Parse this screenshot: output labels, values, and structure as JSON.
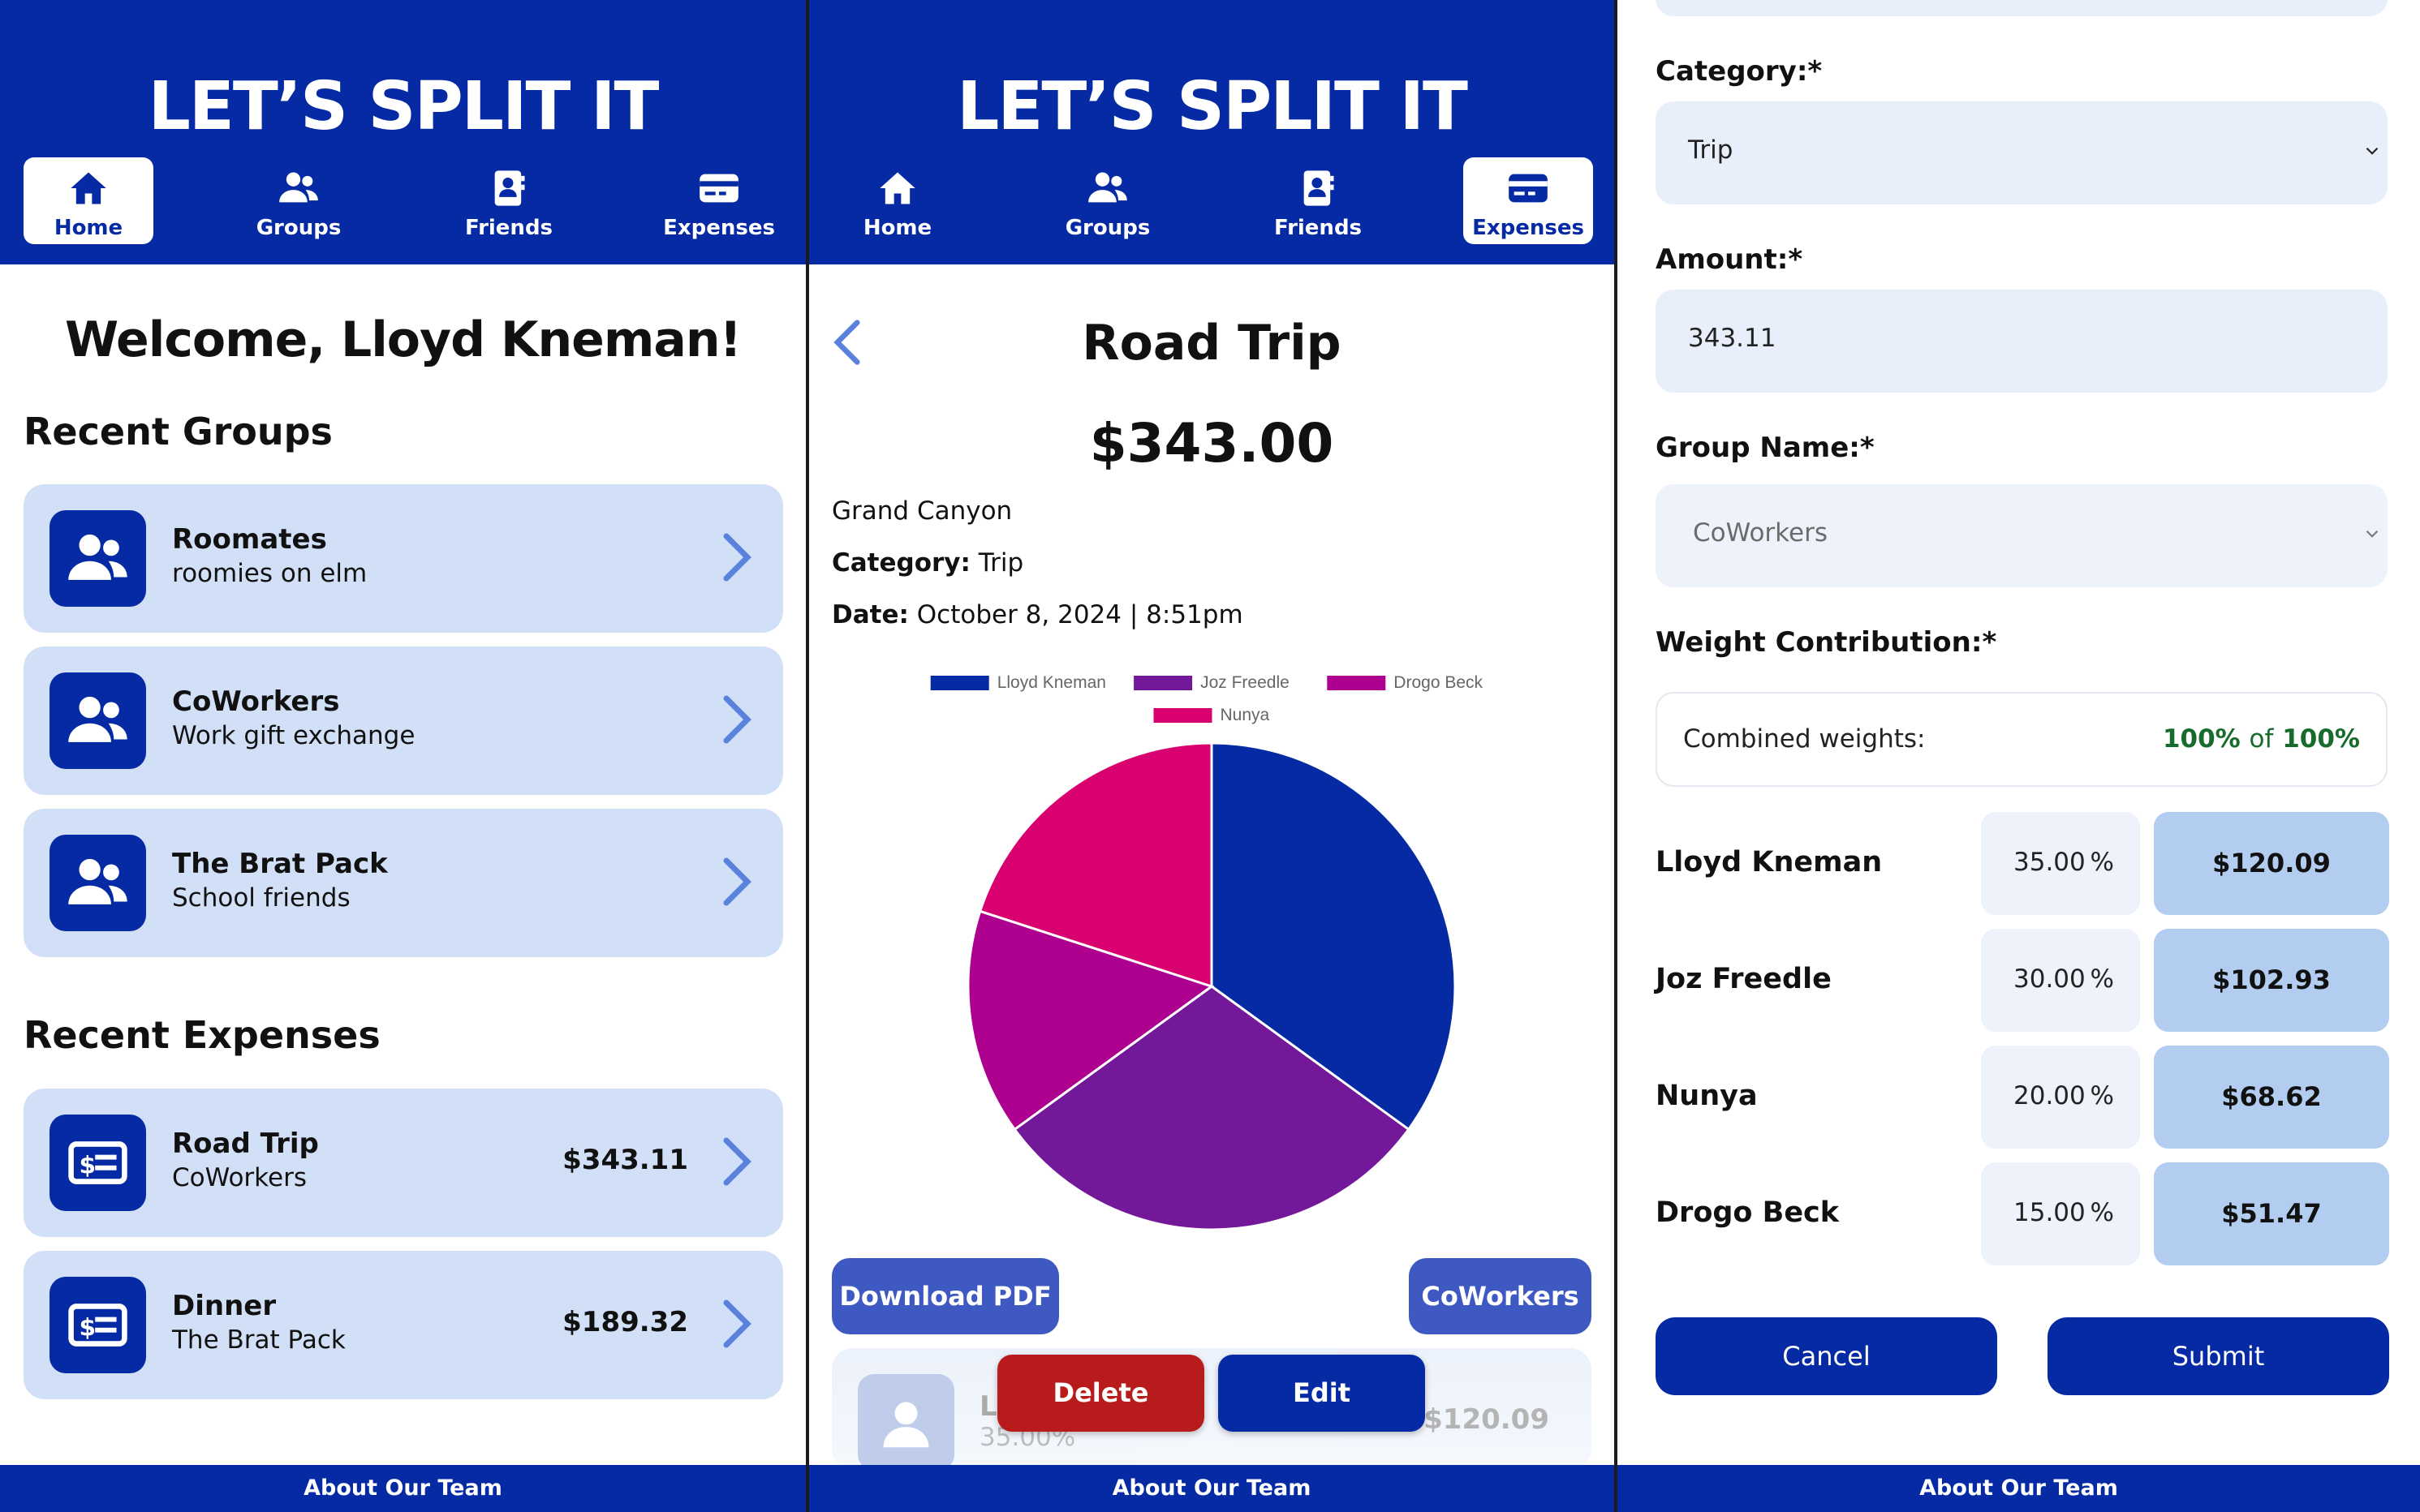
{
  "app": {
    "title": "LET’S SPLIT IT",
    "footer": "About Our Team"
  },
  "nav": {
    "home": "Home",
    "groups": "Groups",
    "friends": "Friends",
    "expenses": "Expenses"
  },
  "home": {
    "welcome": "Welcome, Lloyd Kneman!",
    "recent_groups_title": "Recent Groups",
    "groups": [
      {
        "name": "Roomates",
        "desc": "roomies on elm"
      },
      {
        "name": "CoWorkers",
        "desc": "Work gift exchange"
      },
      {
        "name": "The Brat Pack",
        "desc": "School friends"
      }
    ],
    "recent_expenses_title": "Recent Expenses",
    "expenses": [
      {
        "name": "Road Trip",
        "group": "CoWorkers",
        "amount": "$343.11"
      },
      {
        "name": "Dinner",
        "group": "The Brat Pack",
        "amount": "$189.32"
      }
    ]
  },
  "expense": {
    "title": "Road Trip",
    "amount": "$343.00",
    "description": "Grand Canyon",
    "category_label": "Category:",
    "category": "Trip",
    "date_label": "Date:",
    "date": "October 8, 2024 | 8:51pm",
    "download_label": "Download PDF",
    "group_button": "CoWorkers",
    "delete_label": "Delete",
    "edit_label": "Edit",
    "member_initial": "L",
    "member_pct": "35.00%",
    "member_amount": "$120.09"
  },
  "chart_data": {
    "type": "pie",
    "labels": [
      "Lloyd Kneman",
      "Joz Freedle",
      "Drogo Beck",
      "Nunya"
    ],
    "values": [
      35,
      30,
      15,
      20
    ],
    "colors": [
      "#052aa3",
      "#721899",
      "#ad008f",
      "#d9006f"
    ],
    "legend_position": "top"
  },
  "form": {
    "category_label": "Category:*",
    "category_value": "Trip",
    "amount_label": "Amount:*",
    "amount_value": "343.11",
    "group_label": "Group Name:*",
    "group_value": "CoWorkers",
    "weight_label": "Weight Contribution:*",
    "combined_label": "Combined weights:",
    "combined_pct": "100%",
    "combined_of": "of",
    "combined_total": "100%",
    "pct_unit": "%",
    "members": [
      {
        "name": "Lloyd Kneman",
        "pct": "35.00",
        "amount": "$120.09"
      },
      {
        "name": "Joz Freedle",
        "pct": "30.00",
        "amount": "$102.93"
      },
      {
        "name": "Nunya",
        "pct": "20.00",
        "amount": "$68.62"
      },
      {
        "name": "Drogo Beck",
        "pct": "15.00",
        "amount": "$51.47"
      }
    ],
    "cancel_label": "Cancel",
    "submit_label": "Submit"
  }
}
